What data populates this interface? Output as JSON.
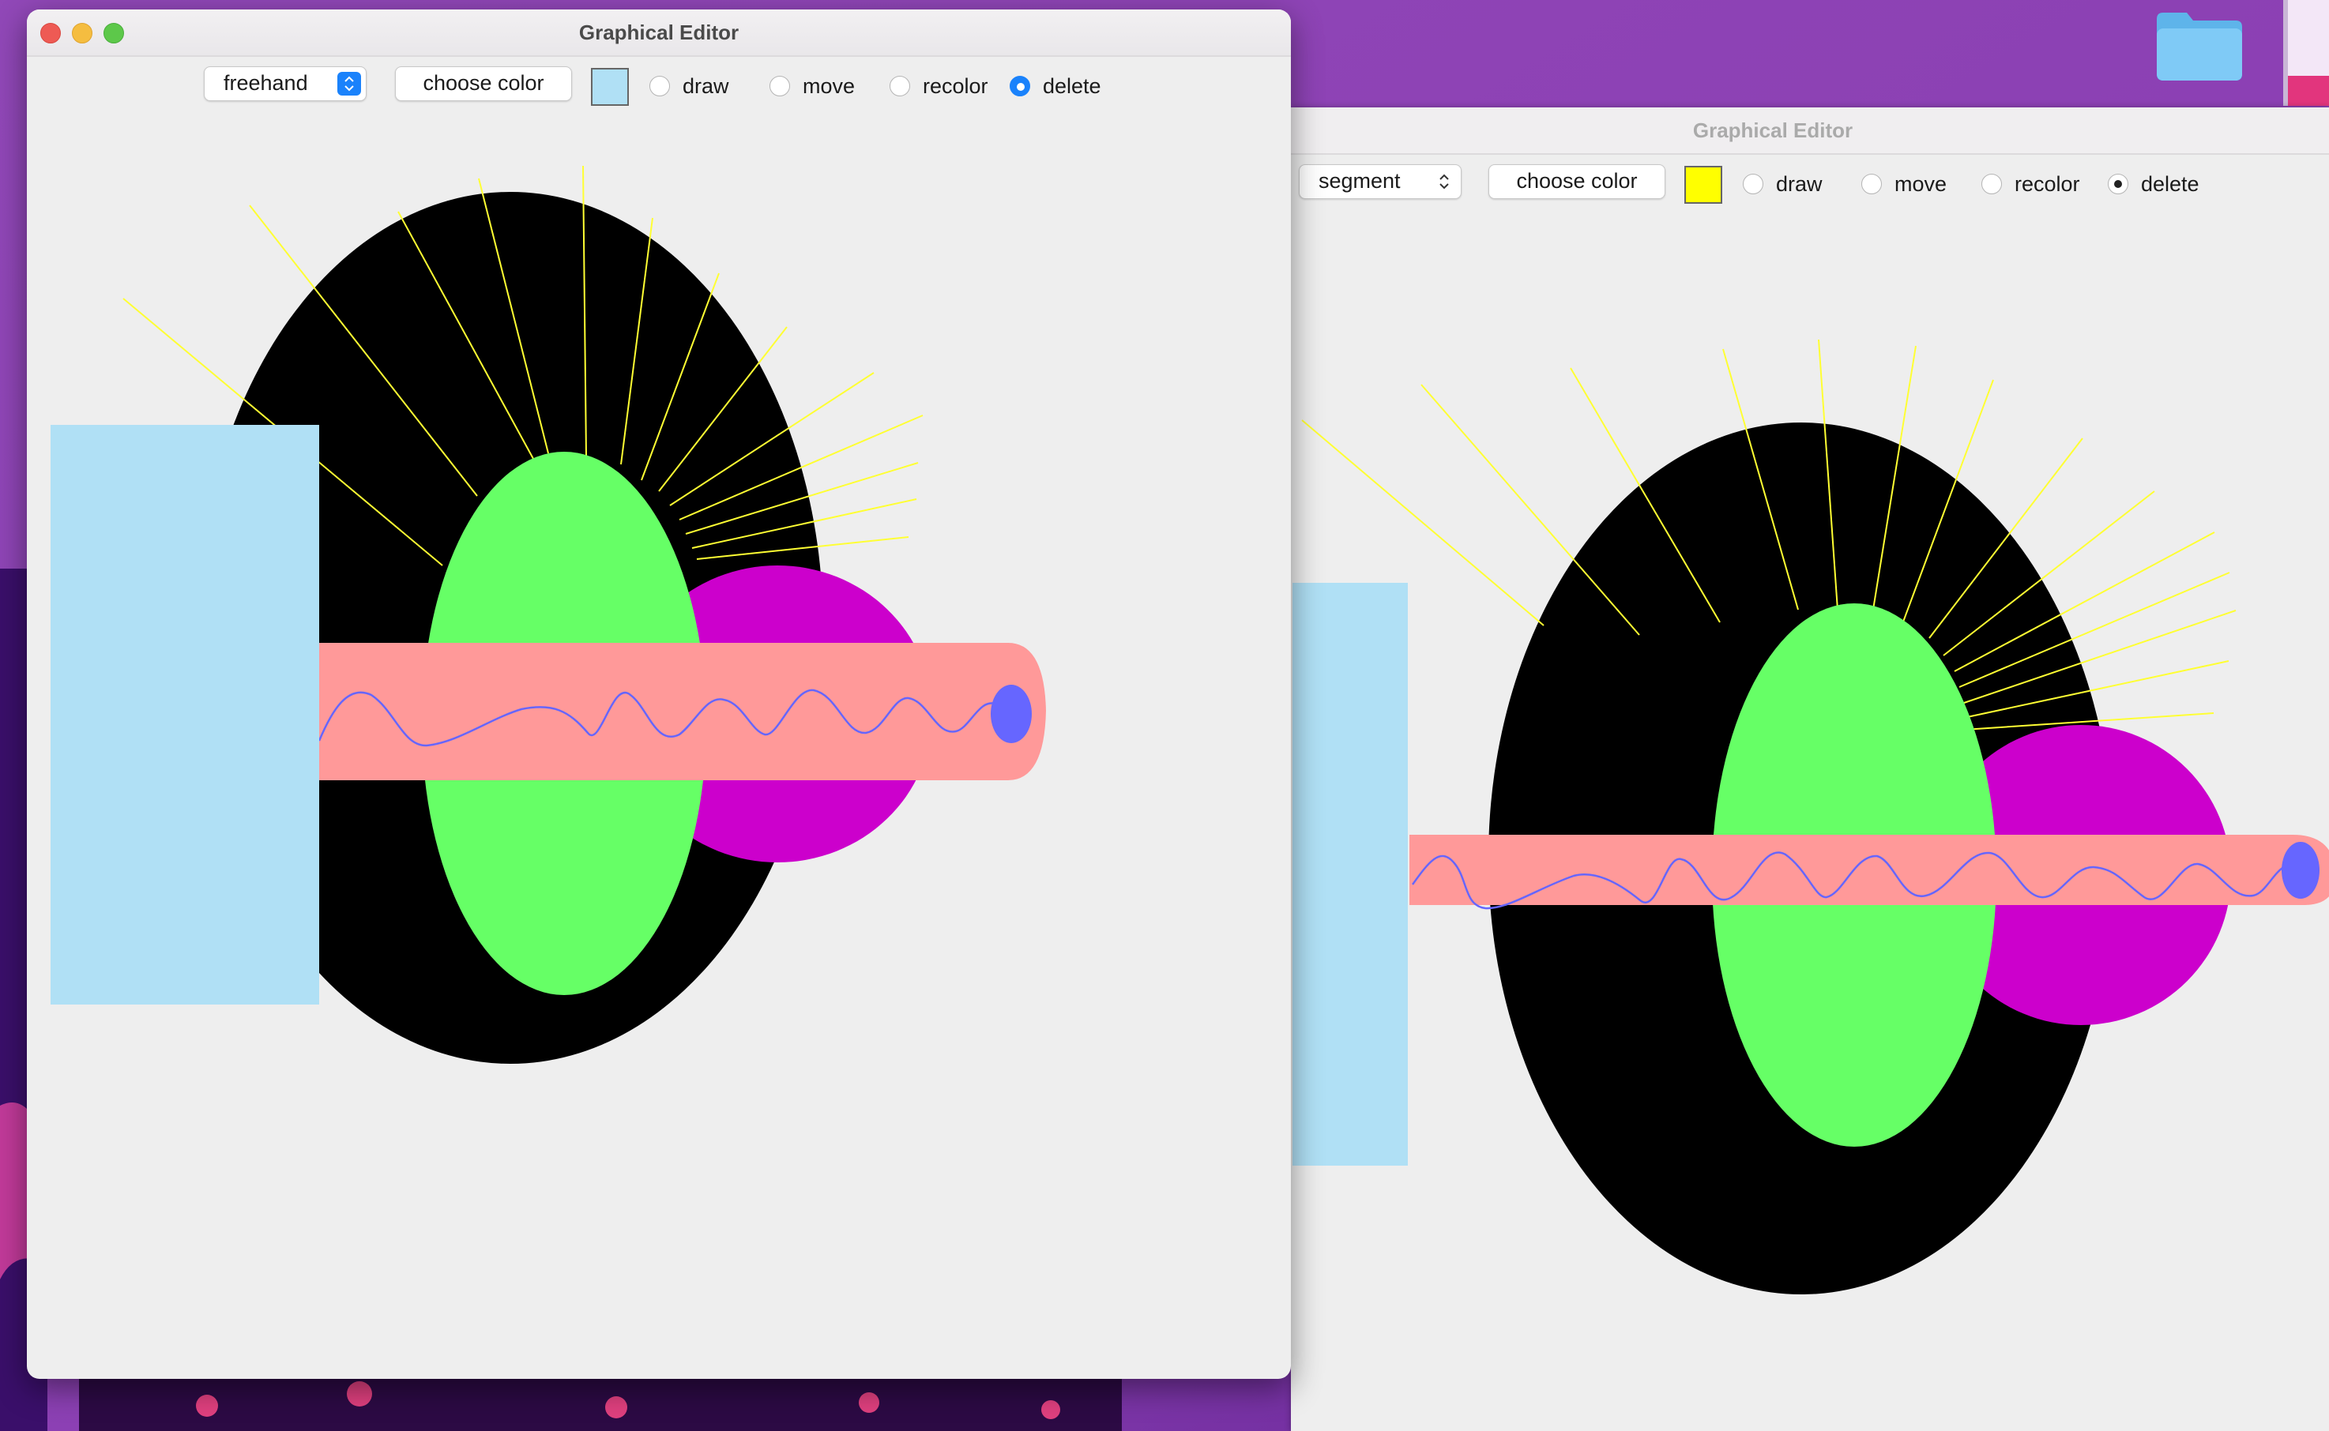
{
  "desktop": {
    "folder_icon": "folder-icon",
    "book_icon": "book-icon"
  },
  "window_front": {
    "title": "Graphical Editor",
    "shape_select": {
      "value": "freehand",
      "icon": "chevron-updown-icon"
    },
    "choose_color_label": "choose color",
    "current_color": "#b0e0f5",
    "modes": [
      {
        "label": "draw",
        "selected": false
      },
      {
        "label": "move",
        "selected": false
      },
      {
        "label": "recolor",
        "selected": false
      },
      {
        "label": "delete",
        "selected": true
      }
    ]
  },
  "window_back": {
    "title": "Graphical Editor",
    "shape_select": {
      "value": "segment",
      "icon": "chevron-updown-icon"
    },
    "choose_color_label": "choose color",
    "current_color": "#ffff00",
    "modes": [
      {
        "label": "draw",
        "selected": false
      },
      {
        "label": "move",
        "selected": false
      },
      {
        "label": "recolor",
        "selected": false
      },
      {
        "label": "delete",
        "selected": true
      }
    ]
  },
  "drawing": {
    "colors": {
      "big_ellipse": "#000000",
      "green_ellipse": "#66ff66",
      "magenta_ellipse": "#cc00cc",
      "pink_bar": "#ff9999",
      "blue_rect": "#b0e0f5",
      "rays": "#ffff33",
      "freehand_line": "#6666ff",
      "blue_dot": "#6666ff"
    }
  }
}
